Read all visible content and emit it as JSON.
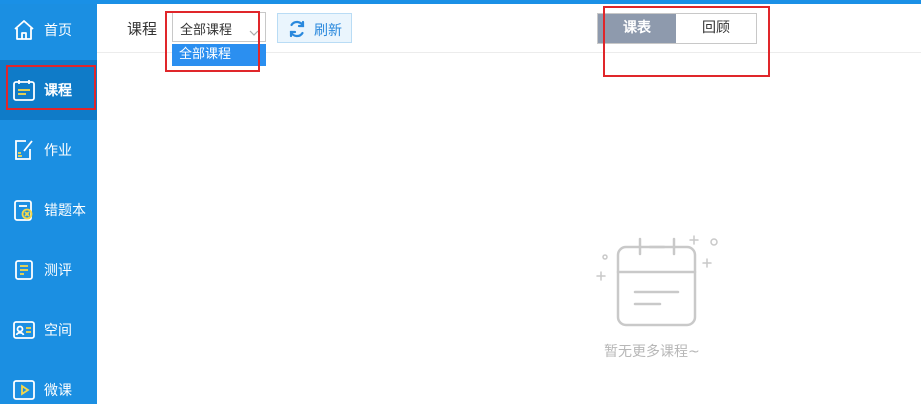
{
  "sidebar": {
    "items": [
      {
        "label": "首页",
        "icon": "home-icon"
      },
      {
        "label": "课程",
        "icon": "calendar-icon",
        "active": true
      },
      {
        "label": "作业",
        "icon": "homework-icon"
      },
      {
        "label": "错题本",
        "icon": "mistake-book-icon"
      },
      {
        "label": "测评",
        "icon": "assessment-icon"
      },
      {
        "label": "空间",
        "icon": "space-icon"
      },
      {
        "label": "微课",
        "icon": "micro-lesson-icon"
      }
    ]
  },
  "toolbar": {
    "course_label": "课程",
    "course_select_value": "全部课程",
    "dropdown_option": "全部课程",
    "refresh_label": "刷新",
    "view_tabs": [
      "课表",
      "回顾"
    ]
  },
  "empty_state": {
    "message": "暂无更多课程~"
  },
  "colors": {
    "sidebar_bg": "#1b8fe2",
    "sidebar_active": "#0f7bc8",
    "accent": "#2a89dd",
    "tab_active_bg": "#8e9aad",
    "highlight_box": "#e0262a"
  }
}
